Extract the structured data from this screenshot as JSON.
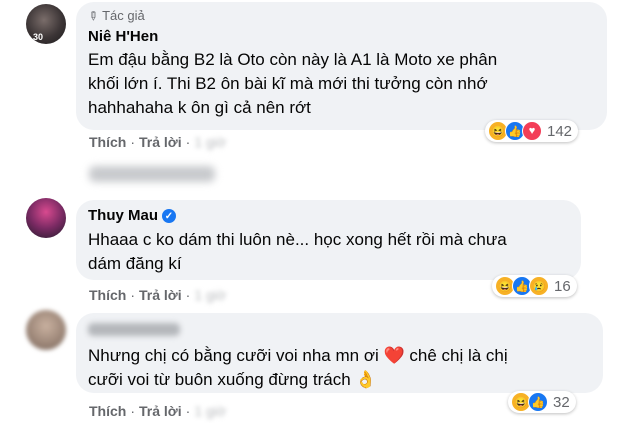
{
  "comments": [
    {
      "author_badge": "Tác giả",
      "name": "Niê H'Hen",
      "avatar_badge": "30",
      "text_lines": [
        "Em đậu bằng B2 là Oto còn này là A1 là Moto xe phân",
        "khối lớn í. Thi B2 ôn bài kĩ mà mới thi tưởng còn nhớ",
        "hahhahaha k ôn gì cả nên rớt"
      ],
      "like_label": "Thích",
      "reply_label": "Trả lời",
      "reaction_count": "142",
      "reactions": [
        "haha-icon",
        "like-icon",
        "love-icon"
      ]
    },
    {
      "name": "Thuy Mau",
      "verified": true,
      "text_lines": [
        "Hhaaa c ko dám thi luôn nè... học xong hết rồi mà chưa",
        "dám đăng kí"
      ],
      "like_label": "Thích",
      "reply_label": "Trả lời",
      "reaction_count": "16",
      "reactions": [
        "haha-icon",
        "like-icon",
        "sad-icon"
      ]
    },
    {
      "text_lines": [
        "Nhưng chị có bằng cưỡi voi nha mn ơi ❤️ chê chị là chị",
        "cưỡi voi từ buôn xuống đừng trách 👌"
      ],
      "like_label": "Thích",
      "reply_label": "Trả lời",
      "reaction_count": "32",
      "reactions": [
        "haha-icon",
        "like-icon"
      ]
    }
  ],
  "colors": {
    "bubble": "#f0f2f5",
    "action_text": "#65676b",
    "like_blue": "#1877f2",
    "love_red": "#f33e58",
    "haha_yellow": "#f7b125"
  }
}
